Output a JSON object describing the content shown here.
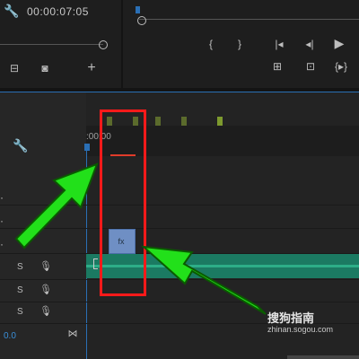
{
  "source": {
    "timecode": "00:00:07:05",
    "icons": [
      "wrench-icon",
      "export-frame-icon",
      "camera-icon",
      "plus-icon"
    ]
  },
  "program": {
    "icons": [
      "mark-in-icon",
      "mark-out-icon",
      "go-to-in-icon",
      "step-back-icon",
      "play-icon",
      "lift-icon",
      "extract-icon",
      "trim-icon"
    ]
  },
  "timeline": {
    "ruler_time": ":00:00",
    "tracks": [
      {
        "label": "S"
      },
      {
        "label": "S"
      },
      {
        "label": "S"
      }
    ],
    "volume": "0.0",
    "icons": [
      "wrench-icon",
      "snap-icon"
    ]
  },
  "watermark": {
    "brand": "搜狗指南",
    "url": "zhinan.sogou.com"
  },
  "colors": {
    "playhead": "#2a6fb5",
    "audio_clip": "#1b7a62",
    "highlight_box": "#ff1a1a",
    "arrow": "#22e01a"
  }
}
